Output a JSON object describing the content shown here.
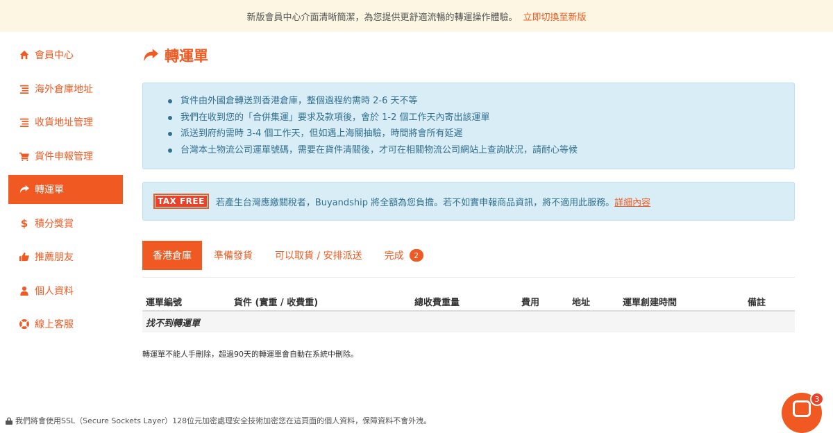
{
  "banner": {
    "message": "新版會員中心介面清晰簡潔，為您提供更舒適流暢的轉運操作體驗。",
    "link": "立即切換至新版"
  },
  "sidebar": {
    "items": [
      {
        "label": "會員中心",
        "icon": "home-icon"
      },
      {
        "label": "海外倉庫地址",
        "icon": "list-icon"
      },
      {
        "label": "收貨地址管理",
        "icon": "list-icon"
      },
      {
        "label": "貨件申報管理",
        "icon": "cart-icon"
      },
      {
        "label": "轉運單",
        "icon": "share-arrow-icon",
        "active": true
      },
      {
        "label": "積分獎賞",
        "icon": "dollar-icon"
      },
      {
        "label": "推薦朋友",
        "icon": "thumbs-up-icon"
      },
      {
        "label": "個人資料",
        "icon": "user-icon"
      },
      {
        "label": "線上客服",
        "icon": "lifebuoy-icon"
      }
    ]
  },
  "page": {
    "title": "轉運單"
  },
  "info": {
    "items": [
      "貨件由外國倉轉送到香港倉庫，整個過程約需時 2-6 天不等",
      "我們在收到您的「合併集運」要求及款項後，會於 1-2 個工作天內寄出該運單",
      "派送到府約需時 3-4 個工作天，但如遇上海關抽驗，時間將會所有延遲",
      "台灣本土物流公司運單號碼，需要在貨件清關後，才可在相關物流公司網站上查詢狀況，請耐心等候"
    ]
  },
  "tax": {
    "badge": "TAX FREE",
    "message": "若產生台灣應繳關稅者，Buyandship 將全額為您負擔。若不如實申報商品資訊，將不適用此服務。",
    "link": "詳細內容"
  },
  "tabs": [
    {
      "label": "香港倉庫",
      "active": true
    },
    {
      "label": "準備發貨"
    },
    {
      "label": "可以取貨 / 安排派送"
    },
    {
      "label": "完成",
      "count": "2"
    }
  ],
  "table": {
    "headers": [
      "運單編號",
      "貨件 (實重 / 收費重)",
      "總收費重量",
      "費用",
      "地址",
      "運單創建時間",
      "備註"
    ],
    "empty": "找不到轉運單"
  },
  "note": "轉運單不能人手刪除，超過90天的轉運單會自動在系統中刪除。",
  "footer": {
    "ssl": "我們將會使用SSL（Secure Sockets Layer）128位元加密處理安全技術加密您在這頁面的個人資料，保障資料不會外洩。"
  },
  "chat": {
    "badge": "3"
  },
  "colors": {
    "accent": "#f05a22",
    "info_bg": "#d9edf7",
    "banner_bg": "#fdf6e3"
  }
}
